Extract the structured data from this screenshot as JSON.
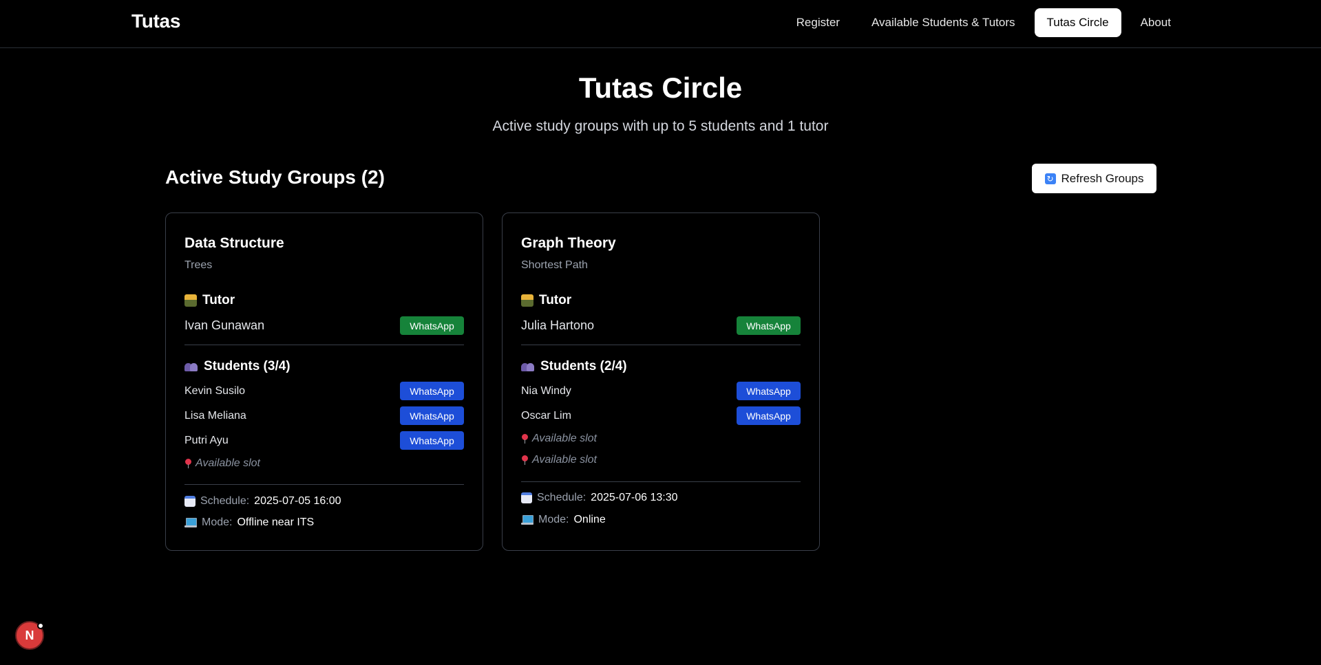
{
  "nav": {
    "brand": "Tutas",
    "links": [
      "Register",
      "Available Students & Tutors",
      "Tutas Circle",
      "About"
    ],
    "active": "Tutas Circle"
  },
  "page": {
    "title": "Tutas Circle",
    "subtitle": "Active study groups with up to 5 students and 1 tutor"
  },
  "section": {
    "title": "Active Study Groups (2)",
    "refresh_label": "Refresh Groups"
  },
  "groups": [
    {
      "subject": "Data Structure",
      "topic": "Trees",
      "tutor_heading": "Tutor",
      "tutor": {
        "name": "Ivan Gunawan",
        "contact": "WhatsApp"
      },
      "students_heading": "Students (3/4)",
      "students": [
        {
          "name": "Kevin Susilo",
          "contact": "WhatsApp"
        },
        {
          "name": "Lisa Meliana",
          "contact": "WhatsApp"
        },
        {
          "name": "Putri Ayu",
          "contact": "WhatsApp"
        }
      ],
      "slots": [
        "Available slot"
      ],
      "schedule_label": "Schedule:",
      "schedule": "2025-07-05 16:00",
      "mode_label": "Mode:",
      "mode": "Offline near ITS"
    },
    {
      "subject": "Graph Theory",
      "topic": "Shortest Path",
      "tutor_heading": "Tutor",
      "tutor": {
        "name": "Julia Hartono",
        "contact": "WhatsApp"
      },
      "students_heading": "Students (2/4)",
      "students": [
        {
          "name": "Nia Windy",
          "contact": "WhatsApp"
        },
        {
          "name": "Oscar Lim",
          "contact": "WhatsApp"
        }
      ],
      "slots": [
        "Available slot",
        "Available slot"
      ],
      "schedule_label": "Schedule:",
      "schedule": "2025-07-06 13:30",
      "mode_label": "Mode:",
      "mode": "Online"
    }
  ],
  "dev_badge": {
    "letter": "N"
  },
  "colors": {
    "background": "#000000",
    "tutor_whatsapp": "#16833a",
    "student_whatsapp": "#1d4ed8",
    "badge": "#d93a3a"
  }
}
